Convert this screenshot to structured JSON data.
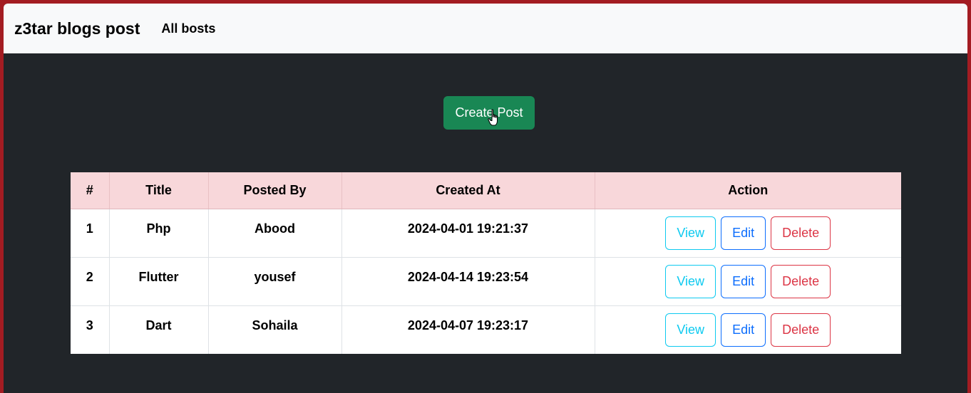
{
  "navbar": {
    "brand": "z3tar blogs post",
    "link": "All bosts"
  },
  "create_button": "Create Post",
  "table": {
    "headers": [
      "#",
      "Title",
      "Posted By",
      "Created At",
      "Action"
    ],
    "rows": [
      {
        "id": "1",
        "title": "Php",
        "posted_by": "Abood",
        "created_at": "2024-04-01 19:21:37"
      },
      {
        "id": "2",
        "title": "Flutter",
        "posted_by": "yousef",
        "created_at": "2024-04-14 19:23:54"
      },
      {
        "id": "3",
        "title": "Dart",
        "posted_by": "Sohaila",
        "created_at": "2024-04-07 19:23:17"
      }
    ],
    "actions": {
      "view": "View",
      "edit": "Edit",
      "delete": "Delete"
    }
  },
  "colors": {
    "frame": "#a31c22",
    "background": "#212529",
    "navbar": "#f8f9fa",
    "header_row": "#f8d7da",
    "success": "#198754",
    "info": "#0dcaf0",
    "primary": "#0d6efd",
    "danger": "#dc3545"
  },
  "cursor": "hand-pointer-icon"
}
